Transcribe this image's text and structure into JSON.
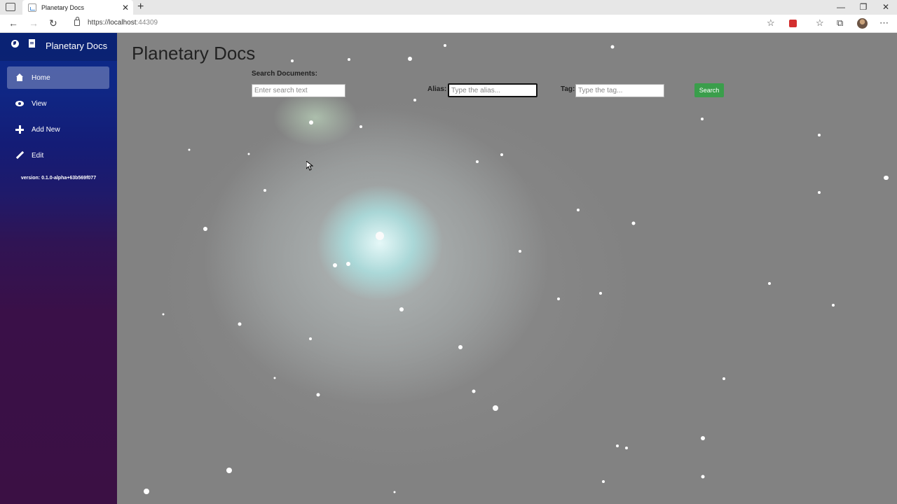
{
  "browser": {
    "tab_title": "Planetary Docs",
    "url_scheme": "https://",
    "url_host": "localhost",
    "url_port": ":44309",
    "icons": [
      "tab-actions-icon",
      "close-icon",
      "new-tab-icon",
      "back-icon",
      "forward-icon",
      "refresh-icon",
      "lock-icon",
      "favorite-add-icon",
      "extension-icon",
      "favorites-icon",
      "collections-icon",
      "profile-avatar",
      "more-icon"
    ]
  },
  "sidebar": {
    "brand": "Planetary Docs",
    "items": [
      {
        "label": "Home",
        "icon": "home-icon",
        "active": true
      },
      {
        "label": "View",
        "icon": "eye-icon",
        "active": false
      },
      {
        "label": "Add New",
        "icon": "plus-icon",
        "active": false
      },
      {
        "label": "Edit",
        "icon": "pencil-icon",
        "active": false
      }
    ],
    "version": "version: 0.1.0-alpha+63b569f077"
  },
  "main": {
    "title": "Planetary Docs",
    "search": {
      "label": "Search Documents:",
      "placeholder": "Enter search text",
      "alias_label": "Alias:",
      "alias_placeholder": "Type the alias...",
      "tag_label": "Tag:",
      "tag_placeholder": "Type the tag...",
      "button": "Search"
    }
  },
  "colors": {
    "sidebar_top": "#0b2a8a",
    "sidebar_bottom": "#3b1044",
    "search_button": "#3a9e4b"
  }
}
